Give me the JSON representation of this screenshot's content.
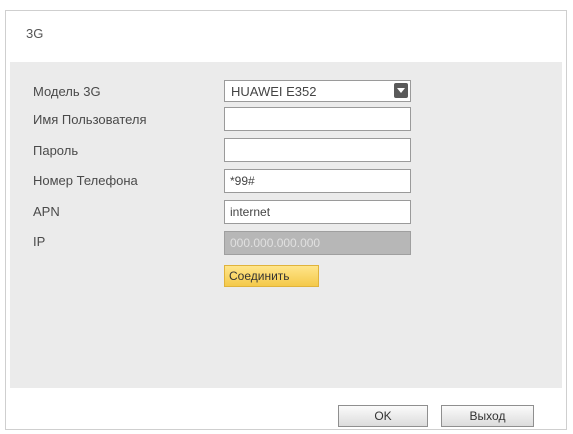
{
  "dialog": {
    "title": "3G"
  },
  "form": {
    "model_label": "Модель 3G",
    "model_value": "HUAWEI E352",
    "username_label": "Имя Пользователя",
    "username_value": "",
    "password_label": "Пароль",
    "password_value": "",
    "phone_label": "Номер Телефона",
    "phone_value": "*99#",
    "apn_label": "APN",
    "apn_value": "internet",
    "ip_label": "IP",
    "ip_value": "000.000.000.000",
    "connect_label": "Соединить"
  },
  "footer": {
    "ok_label": "OK",
    "exit_label": "Выход"
  }
}
